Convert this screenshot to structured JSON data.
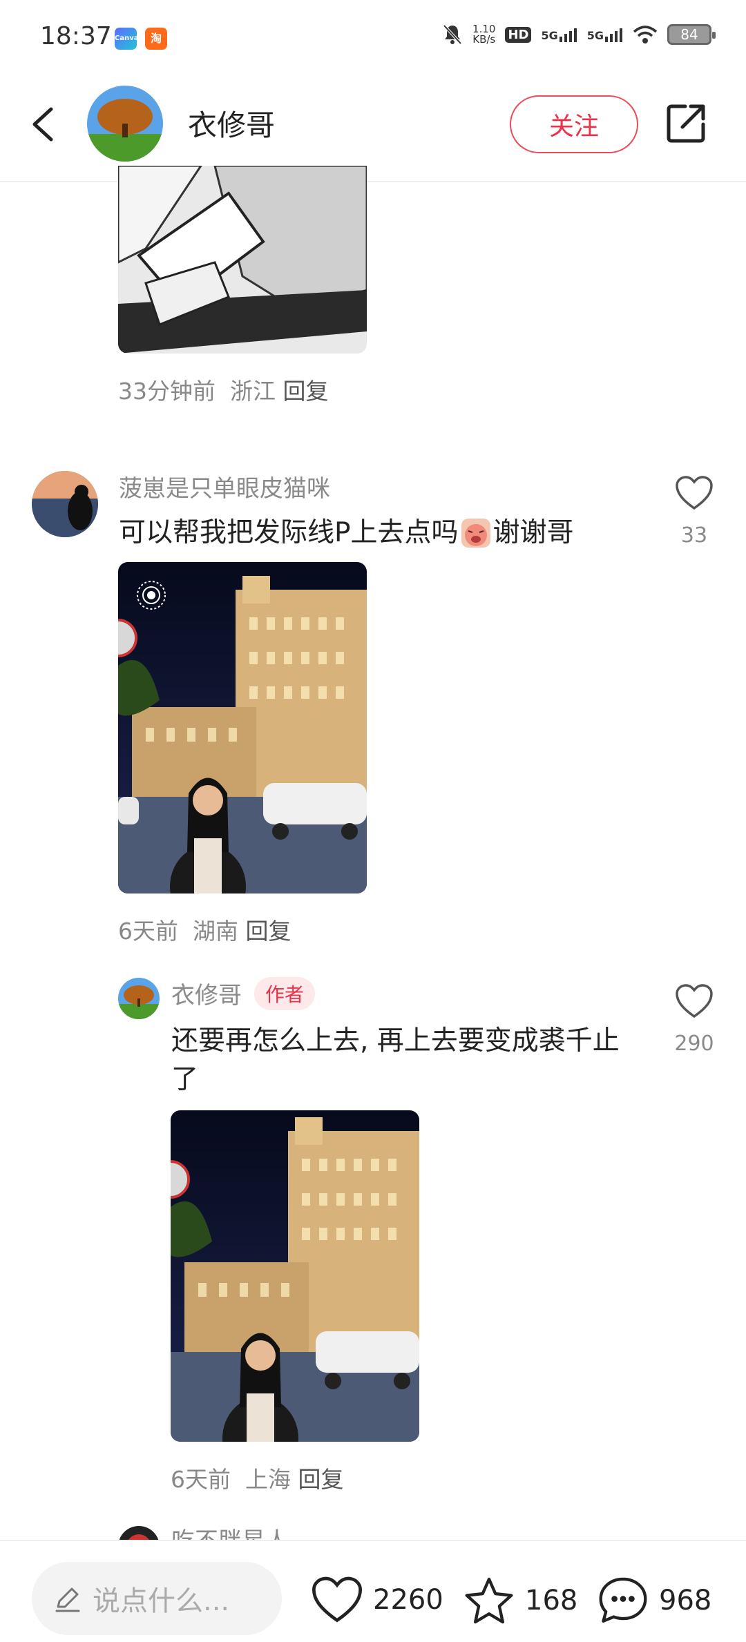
{
  "status_bar": {
    "time": "18:37",
    "app_badges": [
      "Canva",
      "淘"
    ],
    "network_speed": "1.10\nKB/s",
    "signal_labels": [
      "HD",
      "5G",
      "5G"
    ],
    "battery": "84"
  },
  "header": {
    "username": "衣修哥",
    "follow_label": "关注"
  },
  "comments": {
    "first_meta": {
      "time": "33分钟前",
      "location": "浙江",
      "reply": "回复"
    },
    "c1": {
      "username": "菠崽是只单眼皮猫咪",
      "text": "可以帮我把发际线P上去点吗",
      "text_suffix": "谢谢哥",
      "likes": "33",
      "meta": {
        "time": "6天前",
        "location": "湖南",
        "reply": "回复"
      }
    },
    "c2": {
      "username": "衣修哥",
      "tag": "作者",
      "text": "还要再怎么上去, 再上去要变成裘千止了",
      "likes": "290",
      "meta": {
        "time": "6天前",
        "location": "上海",
        "reply": "回复"
      }
    },
    "c3_partial": {
      "username": "吃不胖星人"
    }
  },
  "bottom_bar": {
    "input_placeholder": "说点什么...",
    "likes": "2260",
    "stars": "168",
    "comments": "968"
  },
  "colors": {
    "accent": "#e8334a"
  }
}
